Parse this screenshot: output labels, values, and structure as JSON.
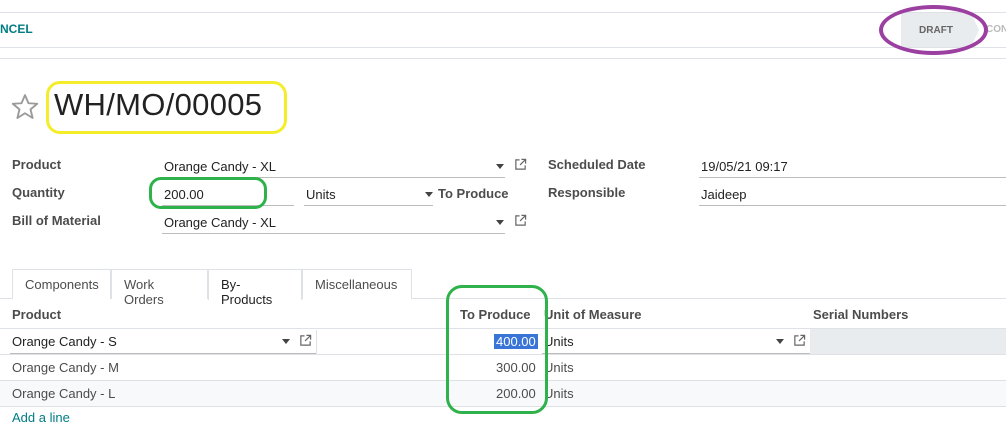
{
  "statusbar": {
    "cancel_label": "NCEL",
    "draft_label": "DRAFT",
    "next_label": "CON"
  },
  "record": {
    "title": "WH/MO/00005"
  },
  "fields": {
    "product_label": "Product",
    "product_value": "Orange Candy - XL",
    "quantity_label": "Quantity",
    "quantity_value": "200.00",
    "uom_value": "Units",
    "to_produce_label": "To Produce",
    "bom_label": "Bill of Material",
    "bom_value": "Orange Candy - XL",
    "scheduled_label": "Scheduled Date",
    "scheduled_value": "19/05/21 09:17",
    "responsible_label": "Responsible",
    "responsible_value": "Jaideep"
  },
  "tabs": [
    {
      "label": "Components"
    },
    {
      "label": "Work Orders"
    },
    {
      "label": "By-Products"
    },
    {
      "label": "Miscellaneous"
    }
  ],
  "table": {
    "headers": {
      "product": "Product",
      "to_produce": "To Produce",
      "uom": "Unit of Measure",
      "serial": "Serial Numbers"
    },
    "rows": [
      {
        "product": "Orange Candy - S",
        "qty": "400.00",
        "uom": "Units"
      },
      {
        "product": "Orange Candy - M",
        "qty": "300.00",
        "uom": "Units"
      },
      {
        "product": "Orange Candy - L",
        "qty": "200.00",
        "uom": "Units"
      }
    ],
    "add_line": "Add a line"
  },
  "colors": {
    "accent": "#017e84",
    "annotation_yellow": "#f4ee2a",
    "annotation_green": "#2fb14b",
    "annotation_purple": "#9b3fa1"
  }
}
